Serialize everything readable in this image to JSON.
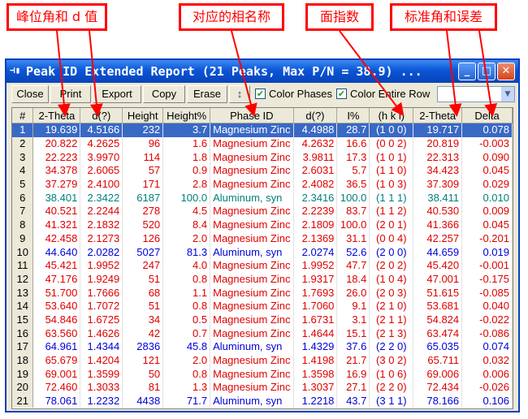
{
  "annotations": {
    "peak_position": "峰位角和 d 值",
    "phase_name": "对应的相名称",
    "indices": "面指数",
    "standard_angle": "标准角和误差"
  },
  "window": {
    "icon_glyph": "⊣▮",
    "title": "Peak ID Extended Report (21 Peaks, Max P/N = 38.9) ...",
    "minimize_glyph": "_",
    "maximize_glyph": "□",
    "close_glyph": "✕"
  },
  "toolbar": {
    "close": "Close",
    "print": "Print",
    "export": "Export",
    "copy": "Copy",
    "erase": "Erase",
    "sort_glyph": "↕",
    "color_phases": "Color Phases",
    "color_entire_row": "Color Entire Row",
    "check_glyph": "✔",
    "select_value": "",
    "select_arrow": "▼"
  },
  "colors": {
    "magnesium_zinc": "#e00000",
    "aluminum_syn": "#0000d8",
    "highlight": "#00807a",
    "selection": "#3869c6"
  },
  "table": {
    "headers": [
      "#",
      "2-Theta",
      "d(?)",
      "Height",
      "Height%",
      "Phase ID",
      "d(?)",
      "I%",
      "(h k l)",
      "2-Theta",
      "Delta"
    ],
    "rows": [
      [
        "1",
        "19.639",
        "4.5166",
        "232",
        "3.7",
        "Magnesium Zinc",
        "4.4988",
        "28.7",
        "(1 0 0)",
        "19.717",
        "0.078"
      ],
      [
        "2",
        "20.822",
        "4.2625",
        "96",
        "1.6",
        "Magnesium Zinc",
        "4.2632",
        "16.6",
        "(0 0 2)",
        "20.819",
        "-0.003"
      ],
      [
        "3",
        "22.223",
        "3.9970",
        "114",
        "1.8",
        "Magnesium Zinc",
        "3.9811",
        "17.3",
        "(1 0 1)",
        "22.313",
        "0.090"
      ],
      [
        "4",
        "34.378",
        "2.6065",
        "57",
        "0.9",
        "Magnesium Zinc",
        "2.6031",
        "5.7",
        "(1 1 0)",
        "34.423",
        "0.045"
      ],
      [
        "5",
        "37.279",
        "2.4100",
        "171",
        "2.8",
        "Magnesium Zinc",
        "2.4082",
        "36.5",
        "(1 0 3)",
        "37.309",
        "0.029"
      ],
      [
        "6",
        "38.401",
        "2.3422",
        "6187",
        "100.0",
        "Aluminum, syn",
        "2.3416",
        "100.0",
        "(1 1 1)",
        "38.411",
        "0.010"
      ],
      [
        "7",
        "40.521",
        "2.2244",
        "278",
        "4.5",
        "Magnesium Zinc",
        "2.2239",
        "83.7",
        "(1 1 2)",
        "40.530",
        "0.009"
      ],
      [
        "8",
        "41.321",
        "2.1832",
        "520",
        "8.4",
        "Magnesium Zinc",
        "2.1809",
        "100.0",
        "(2 0 1)",
        "41.366",
        "0.045"
      ],
      [
        "9",
        "42.458",
        "2.1273",
        "126",
        "2.0",
        "Magnesium Zinc",
        "2.1369",
        "31.1",
        "(0 0 4)",
        "42.257",
        "-0.201"
      ],
      [
        "10",
        "44.640",
        "2.0282",
        "5027",
        "81.3",
        "Aluminum, syn",
        "2.0274",
        "52.6",
        "(2 0 0)",
        "44.659",
        "0.019"
      ],
      [
        "11",
        "45.421",
        "1.9952",
        "247",
        "4.0",
        "Magnesium Zinc",
        "1.9952",
        "47.7",
        "(2 0 2)",
        "45.420",
        "-0.001"
      ],
      [
        "12",
        "47.176",
        "1.9249",
        "51",
        "0.8",
        "Magnesium Zinc",
        "1.9317",
        "18.4",
        "(1 0 4)",
        "47.001",
        "-0.175"
      ],
      [
        "13",
        "51.700",
        "1.7666",
        "68",
        "1.1",
        "Magnesium Zinc",
        "1.7693",
        "26.0",
        "(2 0 3)",
        "51.615",
        "-0.085"
      ],
      [
        "14",
        "53.640",
        "1.7072",
        "51",
        "0.8",
        "Magnesium Zinc",
        "1.7060",
        "9.1",
        "(2 1 0)",
        "53.681",
        "0.040"
      ],
      [
        "15",
        "54.846",
        "1.6725",
        "34",
        "0.5",
        "Magnesium Zinc",
        "1.6731",
        "3.1",
        "(2 1 1)",
        "54.824",
        "-0.022"
      ],
      [
        "16",
        "63.560",
        "1.4626",
        "42",
        "0.7",
        "Magnesium Zinc",
        "1.4644",
        "15.1",
        "(2 1 3)",
        "63.474",
        "-0.086"
      ],
      [
        "17",
        "64.961",
        "1.4344",
        "2836",
        "45.8",
        "Aluminum, syn",
        "1.4329",
        "37.6",
        "(2 2 0)",
        "65.035",
        "0.074"
      ],
      [
        "18",
        "65.679",
        "1.4204",
        "121",
        "2.0",
        "Magnesium Zinc",
        "1.4198",
        "21.7",
        "(3 0 2)",
        "65.711",
        "0.032"
      ],
      [
        "19",
        "69.001",
        "1.3599",
        "50",
        "0.8",
        "Magnesium Zinc",
        "1.3598",
        "16.9",
        "(1 0 6)",
        "69.006",
        "0.006"
      ],
      [
        "20",
        "72.460",
        "1.3033",
        "81",
        "1.3",
        "Magnesium Zinc",
        "1.3037",
        "27.1",
        "(2 2 0)",
        "72.434",
        "-0.026"
      ],
      [
        "21",
        "78.061",
        "1.2232",
        "4438",
        "71.7",
        "Aluminum, syn",
        "1.2218",
        "43.7",
        "(3 1 1)",
        "78.166",
        "0.106"
      ]
    ],
    "row_styles": [
      "selected",
      "mg",
      "mg",
      "mg",
      "mg",
      "teal",
      "mg",
      "mg",
      "mg",
      "al",
      "mg",
      "mg",
      "mg",
      "mg",
      "mg",
      "mg",
      "al",
      "mg",
      "mg",
      "mg",
      "al"
    ]
  }
}
